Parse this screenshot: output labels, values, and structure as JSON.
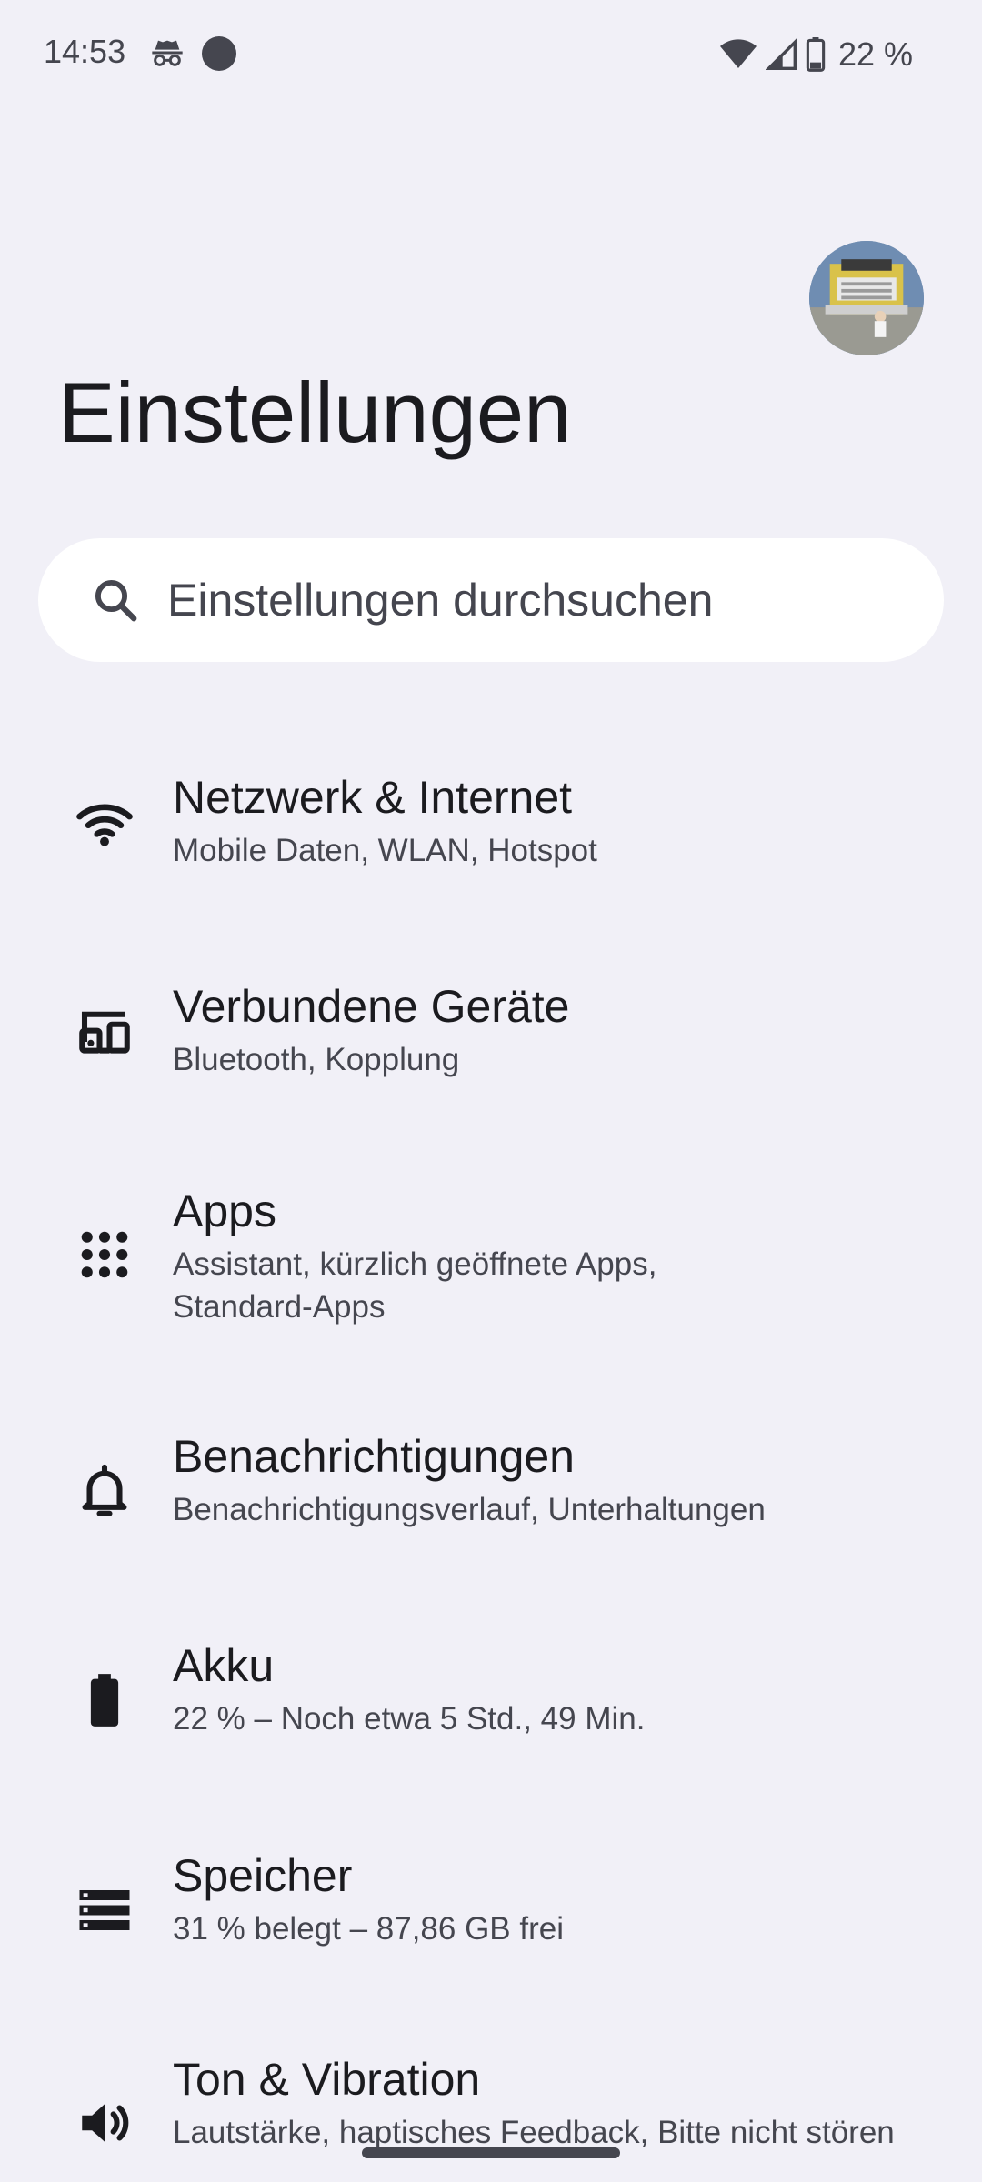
{
  "status_bar": {
    "time": "14:53",
    "battery_percent": "22 %",
    "icons": [
      "incognito-icon",
      "circle-dot-icon",
      "wifi-icon",
      "cell-signal-icon",
      "battery-icon"
    ]
  },
  "header": {
    "title": "Einstellungen",
    "avatar": "profile-avatar"
  },
  "search": {
    "placeholder": "Einstellungen durchsuchen",
    "icon": "search-icon"
  },
  "settings": [
    {
      "title": "Netzwerk & Internet",
      "subtitle": "Mobile Daten, WLAN, Hotspot",
      "icon": "wifi-icon"
    },
    {
      "title": "Verbundene Geräte",
      "subtitle": "Bluetooth, Kopplung",
      "icon": "connected-devices-icon"
    },
    {
      "title": "Apps",
      "subtitle": "Assistant, kürzlich geöffnete Apps,\nStandard-Apps",
      "icon": "apps-grid-icon"
    },
    {
      "title": "Benachrichtigungen",
      "subtitle": "Benachrichtigungsverlauf, Unterhaltungen",
      "icon": "bell-icon"
    },
    {
      "title": "Akku",
      "subtitle": "22 % – Noch etwa 5 Std., 49 Min.",
      "icon": "battery-icon"
    },
    {
      "title": "Speicher",
      "subtitle": "31 % belegt – 87,86 GB frei",
      "icon": "storage-icon"
    },
    {
      "title": "Ton & Vibration",
      "subtitle": "Lautstärke, haptisches Feedback, Bitte nicht stören",
      "icon": "volume-icon"
    }
  ],
  "colors": {
    "background": "#f1f0f7",
    "surface": "#ffffff",
    "text_primary": "#1b1b1f",
    "text_secondary": "#45464f"
  }
}
